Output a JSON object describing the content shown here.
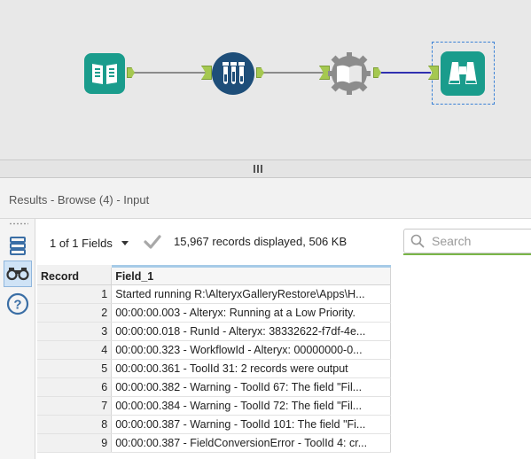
{
  "colors": {
    "tool_teal": "#1a9c8c",
    "tool_navy": "#1e4e79",
    "tool_grey": "#8c8c8c",
    "anchor_green": "#a5c850",
    "connection_grey": "#8a8a8a",
    "connection_blue": "#3030b0",
    "selection_blue": "#3b82d6"
  },
  "canvas": {
    "tools": [
      {
        "name": "input-tool",
        "icon": "book-icon"
      },
      {
        "name": "test-tool",
        "icon": "test-tubes-icon"
      },
      {
        "name": "run-command-tool",
        "icon": "gear-book-icon"
      },
      {
        "name": "browse-tool",
        "icon": "binoculars-icon"
      }
    ]
  },
  "results": {
    "title": "Results - Browse (4) - Input",
    "fields_selector": "1 of 1 Fields",
    "records_info": "15,967 records displayed, 506 KB",
    "search": {
      "placeholder": "Search",
      "value": ""
    },
    "left_toolbar": [
      "table-icon",
      "binoculars-icon",
      "help-icon"
    ],
    "columns": [
      "Record",
      "Field_1"
    ],
    "rows": [
      {
        "record": "1",
        "value": "Started running R:\\AlteryxGalleryRestore\\Apps\\H..."
      },
      {
        "record": "2",
        "value": "00:00:00.003 - Alteryx: Running at a Low Priority."
      },
      {
        "record": "3",
        "value": "00:00:00.018 - RunId - Alteryx: 38332622-f7df-4e..."
      },
      {
        "record": "4",
        "value": "00:00:00.323 - WorkflowId - Alteryx: 00000000-0..."
      },
      {
        "record": "5",
        "value": "00:00:00.361 - ToolId 31: 2 records were output"
      },
      {
        "record": "6",
        "value": "00:00:00.382 - Warning - ToolId 67: The field \"Fil..."
      },
      {
        "record": "7",
        "value": "00:00:00.384 - Warning - ToolId 72: The field \"Fil..."
      },
      {
        "record": "8",
        "value": "00:00:00.387 - Warning - ToolId 101: The field \"Fi..."
      },
      {
        "record": "9",
        "value": "00:00:00.387 - FieldConversionError - ToolId 4: cr..."
      }
    ]
  }
}
